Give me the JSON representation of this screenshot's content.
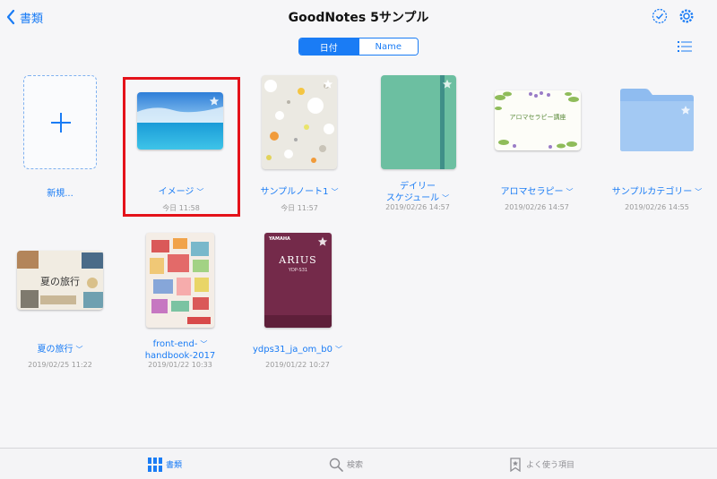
{
  "nav": {
    "back_label": "書類",
    "title": "GoodNotes 5サンプル"
  },
  "sort": {
    "date_label": "日付",
    "name_label": "Name"
  },
  "items": [
    {
      "label": "新規...",
      "date": ""
    },
    {
      "label": "イメージ",
      "date": "今日 11:58"
    },
    {
      "label": "サンプルノート1",
      "date": "今日 11:57"
    },
    {
      "label_line1": "デイリー",
      "label_line2": "スケジュール",
      "date": "2019/02/26 14:57"
    },
    {
      "label": "アロマセラピー",
      "date": "2019/02/26 14:57",
      "cover_text": "アロマセラピー講座"
    },
    {
      "label": "サンプルカテゴリー",
      "date": "2019/02/26 14:55"
    },
    {
      "label": "夏の旅行",
      "date": "2019/02/25 11:22",
      "cover_text": "夏の旅行"
    },
    {
      "label_line1": "front-end-",
      "label_line2": "handbook-2017",
      "date": "2019/01/22 10:33"
    },
    {
      "label": "ydps31_ja_om_b0",
      "date": "2019/01/22 10:27",
      "cover_brand": "YAMAHA",
      "cover_title": "ARIUS",
      "cover_model": "YDP-S31"
    }
  ],
  "tabs": {
    "documents": "書類",
    "search": "検索",
    "favorites": "よく使う項目"
  },
  "colors": {
    "accent": "#1a7cf5",
    "highlight": "#e4121a"
  }
}
